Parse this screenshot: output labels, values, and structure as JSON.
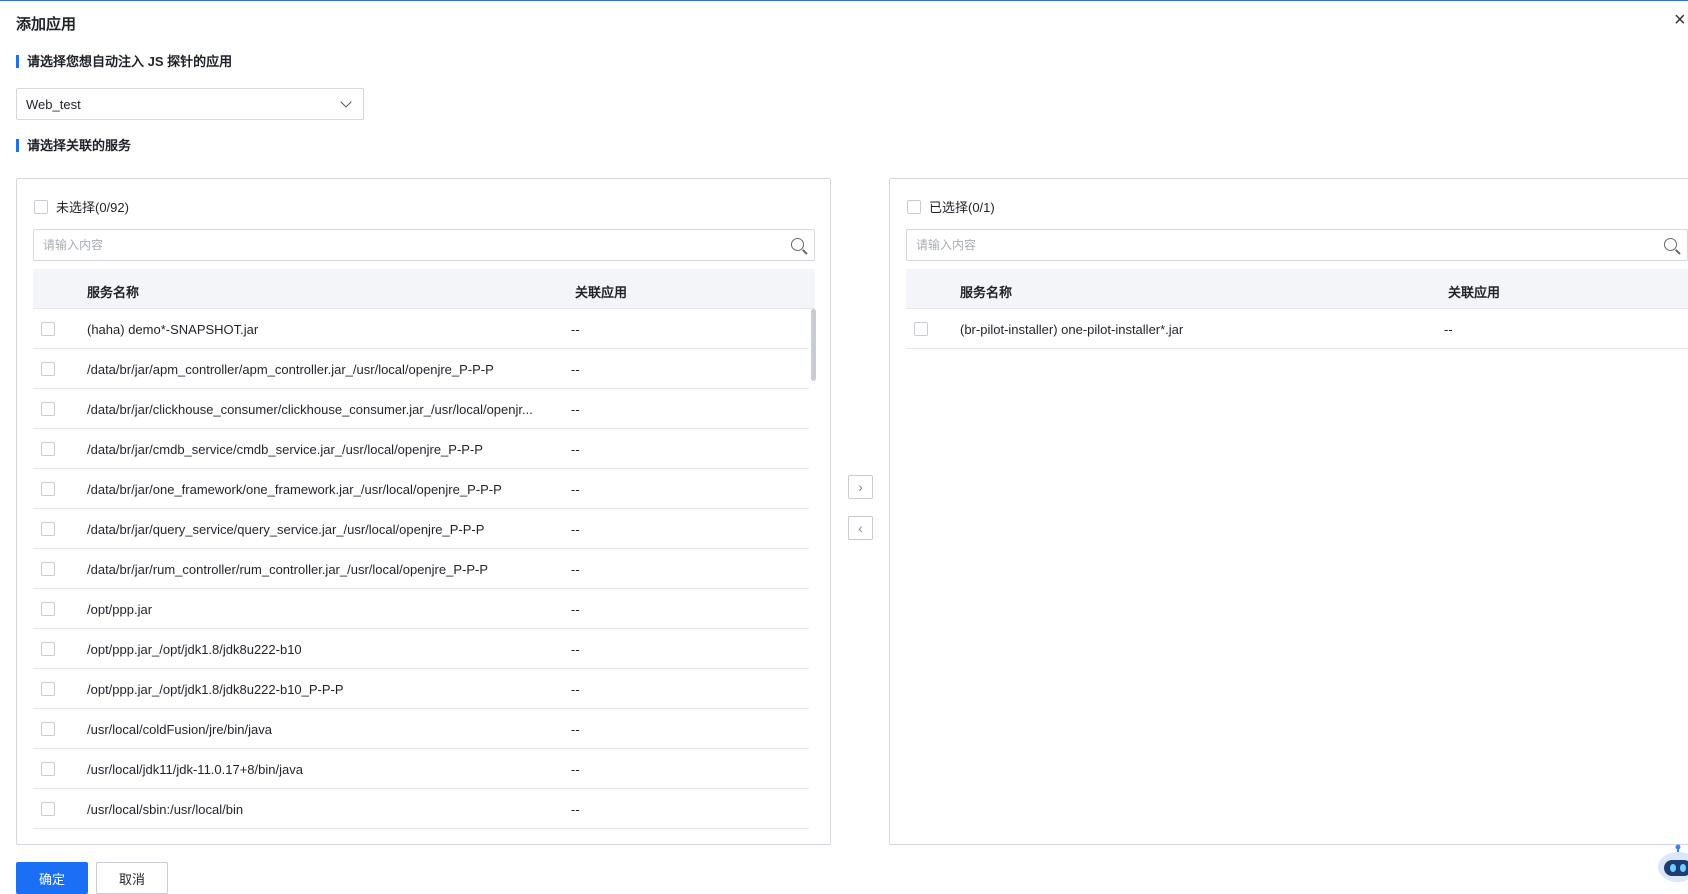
{
  "dialog": {
    "title": "添加应用"
  },
  "section_app": {
    "title": "请选择您想自动注入 JS 探针的应用",
    "selected_value": "Web_test"
  },
  "section_service": {
    "title": "请选择关联的服务"
  },
  "left_panel": {
    "header": "未选择(0/92)",
    "search_placeholder": "请输入内容",
    "columns": [
      "服务名称",
      "关联应用"
    ],
    "rows": [
      {
        "name": "(haha) demo*-SNAPSHOT.jar",
        "app": "--"
      },
      {
        "name": "/data/br/jar/apm_controller/apm_controller.jar_/usr/local/openjre_P-P-P",
        "app": "--"
      },
      {
        "name": "/data/br/jar/clickhouse_consumer/clickhouse_consumer.jar_/usr/local/openjr...",
        "app": "--"
      },
      {
        "name": "/data/br/jar/cmdb_service/cmdb_service.jar_/usr/local/openjre_P-P-P",
        "app": "--"
      },
      {
        "name": "/data/br/jar/one_framework/one_framework.jar_/usr/local/openjre_P-P-P",
        "app": "--"
      },
      {
        "name": "/data/br/jar/query_service/query_service.jar_/usr/local/openjre_P-P-P",
        "app": "--"
      },
      {
        "name": "/data/br/jar/rum_controller/rum_controller.jar_/usr/local/openjre_P-P-P",
        "app": "--"
      },
      {
        "name": "/opt/ppp.jar",
        "app": "--"
      },
      {
        "name": "/opt/ppp.jar_/opt/jdk1.8/jdk8u222-b10",
        "app": "--"
      },
      {
        "name": "/opt/ppp.jar_/opt/jdk1.8/jdk8u222-b10_P-P-P",
        "app": "--"
      },
      {
        "name": "/usr/local/coldFusion/jre/bin/java",
        "app": "--"
      },
      {
        "name": "/usr/local/jdk11/jdk-11.0.17+8/bin/java",
        "app": "--"
      },
      {
        "name": "/usr/local/sbin:/usr/local/bin",
        "app": "--"
      }
    ]
  },
  "right_panel": {
    "header": "已选择(0/1)",
    "search_placeholder": "请输入内容",
    "columns": [
      "服务名称",
      "关联应用"
    ],
    "rows": [
      {
        "name": "(br-pilot-installer) one-pilot-installer*.jar",
        "app": "--"
      }
    ]
  },
  "transfer": {
    "to_right": "›",
    "to_left": "‹"
  },
  "footer": {
    "confirm_label": "确定",
    "cancel_label": "取消"
  },
  "icons": {
    "close": "close-icon",
    "dropdown": "chevron-down-icon",
    "search": "search-icon",
    "assistant": "robot-icon"
  },
  "colors": {
    "accent": "#1a6ff5",
    "border": "#d4d7dc",
    "header_bg": "#f3f5f8"
  }
}
